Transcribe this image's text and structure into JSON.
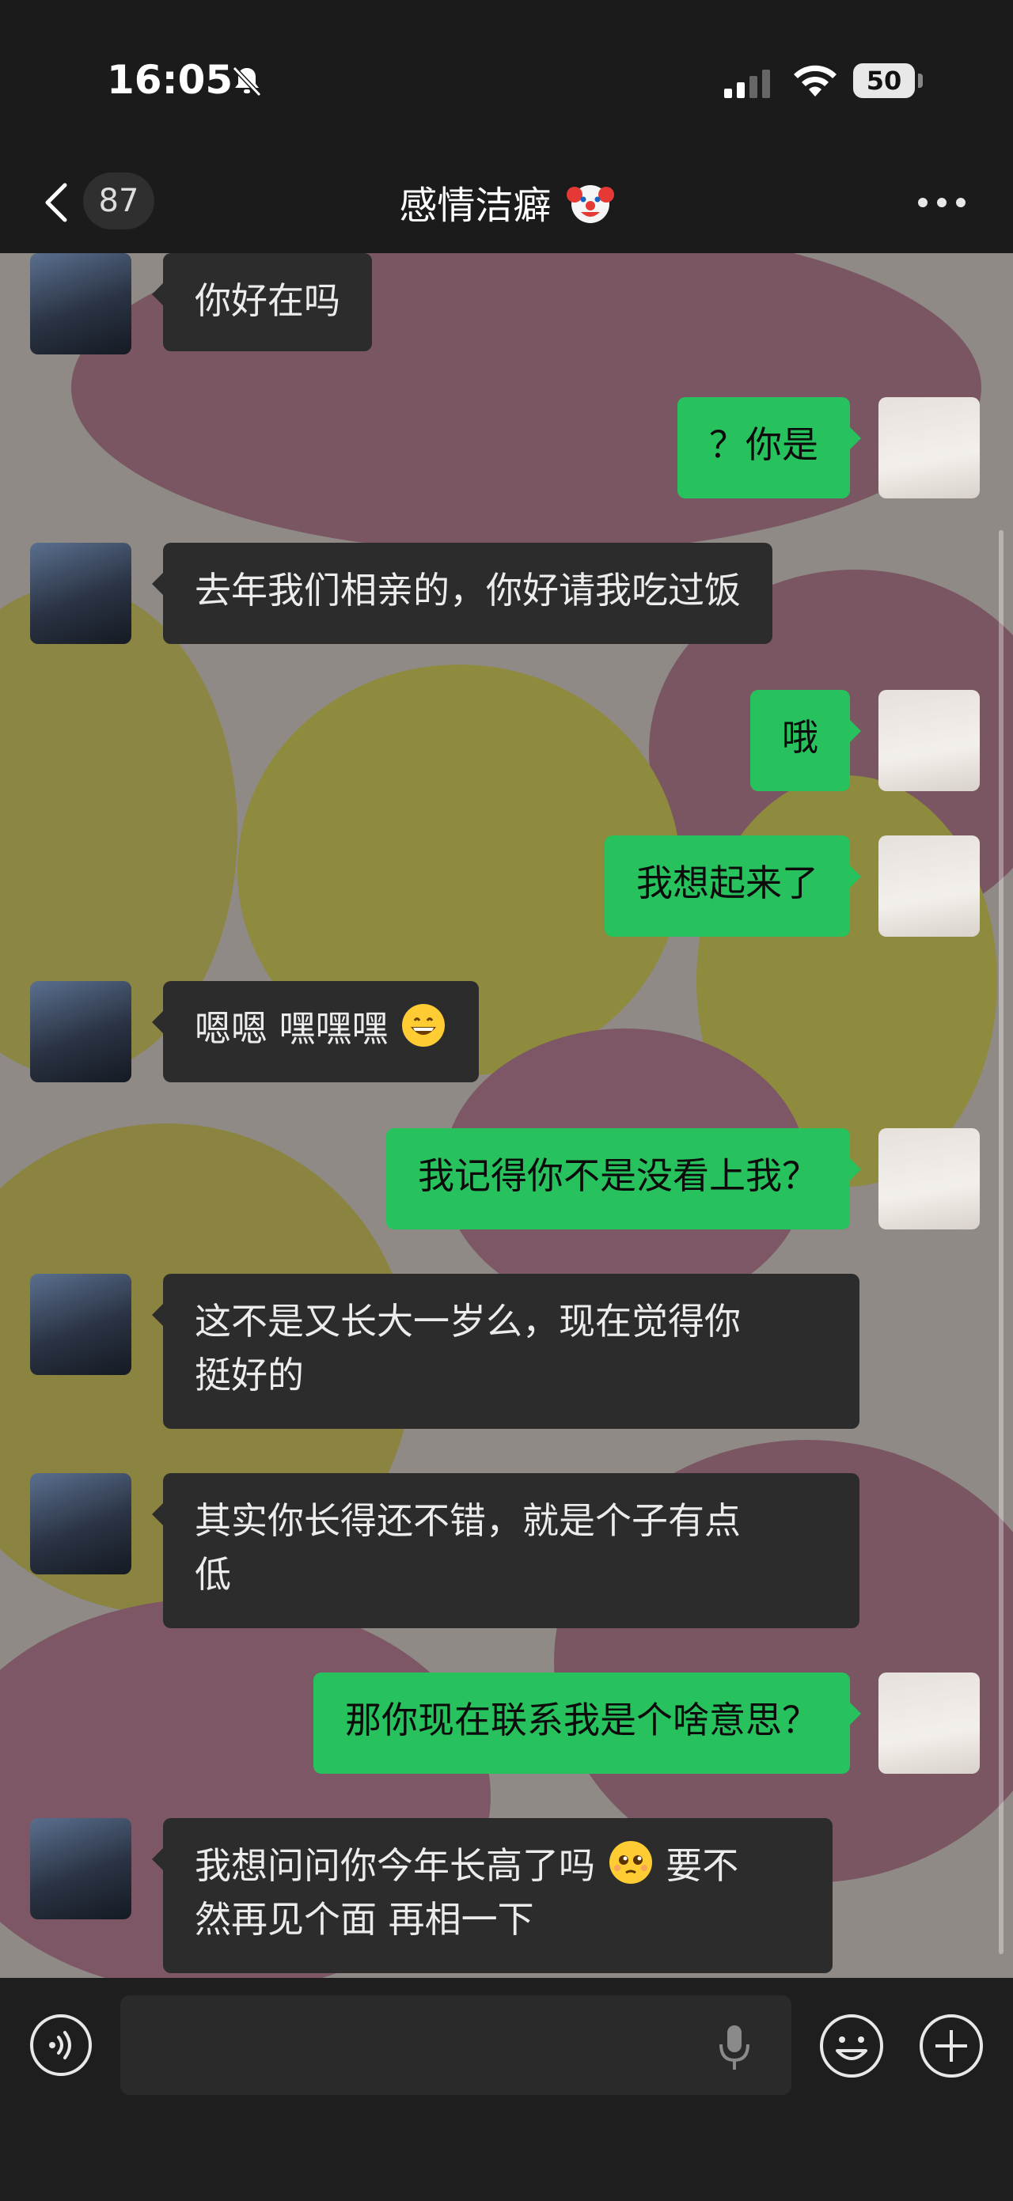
{
  "status_bar": {
    "time": "16:05",
    "battery": "50"
  },
  "nav": {
    "unread_count": "87",
    "title": "感情洁癖"
  },
  "messages": [
    {
      "side": "in",
      "text": "你好在吗"
    },
    {
      "side": "out",
      "text": "？你是"
    },
    {
      "side": "in",
      "text": "去年我们相亲的，你好请我吃过饭"
    },
    {
      "side": "out",
      "text": "哦"
    },
    {
      "side": "out",
      "text": "我想起来了"
    },
    {
      "side": "in",
      "text": "嗯嗯 嘿嘿嘿"
    },
    {
      "side": "out",
      "text": "我记得你不是没看上我？"
    },
    {
      "side": "in",
      "line1": "这不是又长大一岁么，现在觉得你",
      "line2": "挺好的"
    },
    {
      "side": "in",
      "line1": "其实你长得还不错，就是个子有点",
      "line2": "低"
    },
    {
      "side": "out",
      "text": "那你现在联系我是个啥意思？"
    },
    {
      "side": "in",
      "line1a": "我想问问你今年长高了吗",
      "line1b": "要不",
      "line2": "然再见个面 再相一下"
    }
  ],
  "input": {
    "placeholder": ""
  },
  "colors": {
    "outgoing_bubble": "#27c25d",
    "incoming_bubble": "#2c2c2c",
    "background": "#1b1b1b"
  },
  "icons": {
    "back": "chevron-left-icon",
    "more": "ellipsis-icon",
    "voice": "voice-icon",
    "mic": "microphone-icon",
    "emoji": "smiley-icon",
    "plus": "plus-icon",
    "title_emoji": "clown-face-icon",
    "grin_emoji": "grinning-face-icon",
    "pleading_emoji": "pleading-face-icon"
  }
}
